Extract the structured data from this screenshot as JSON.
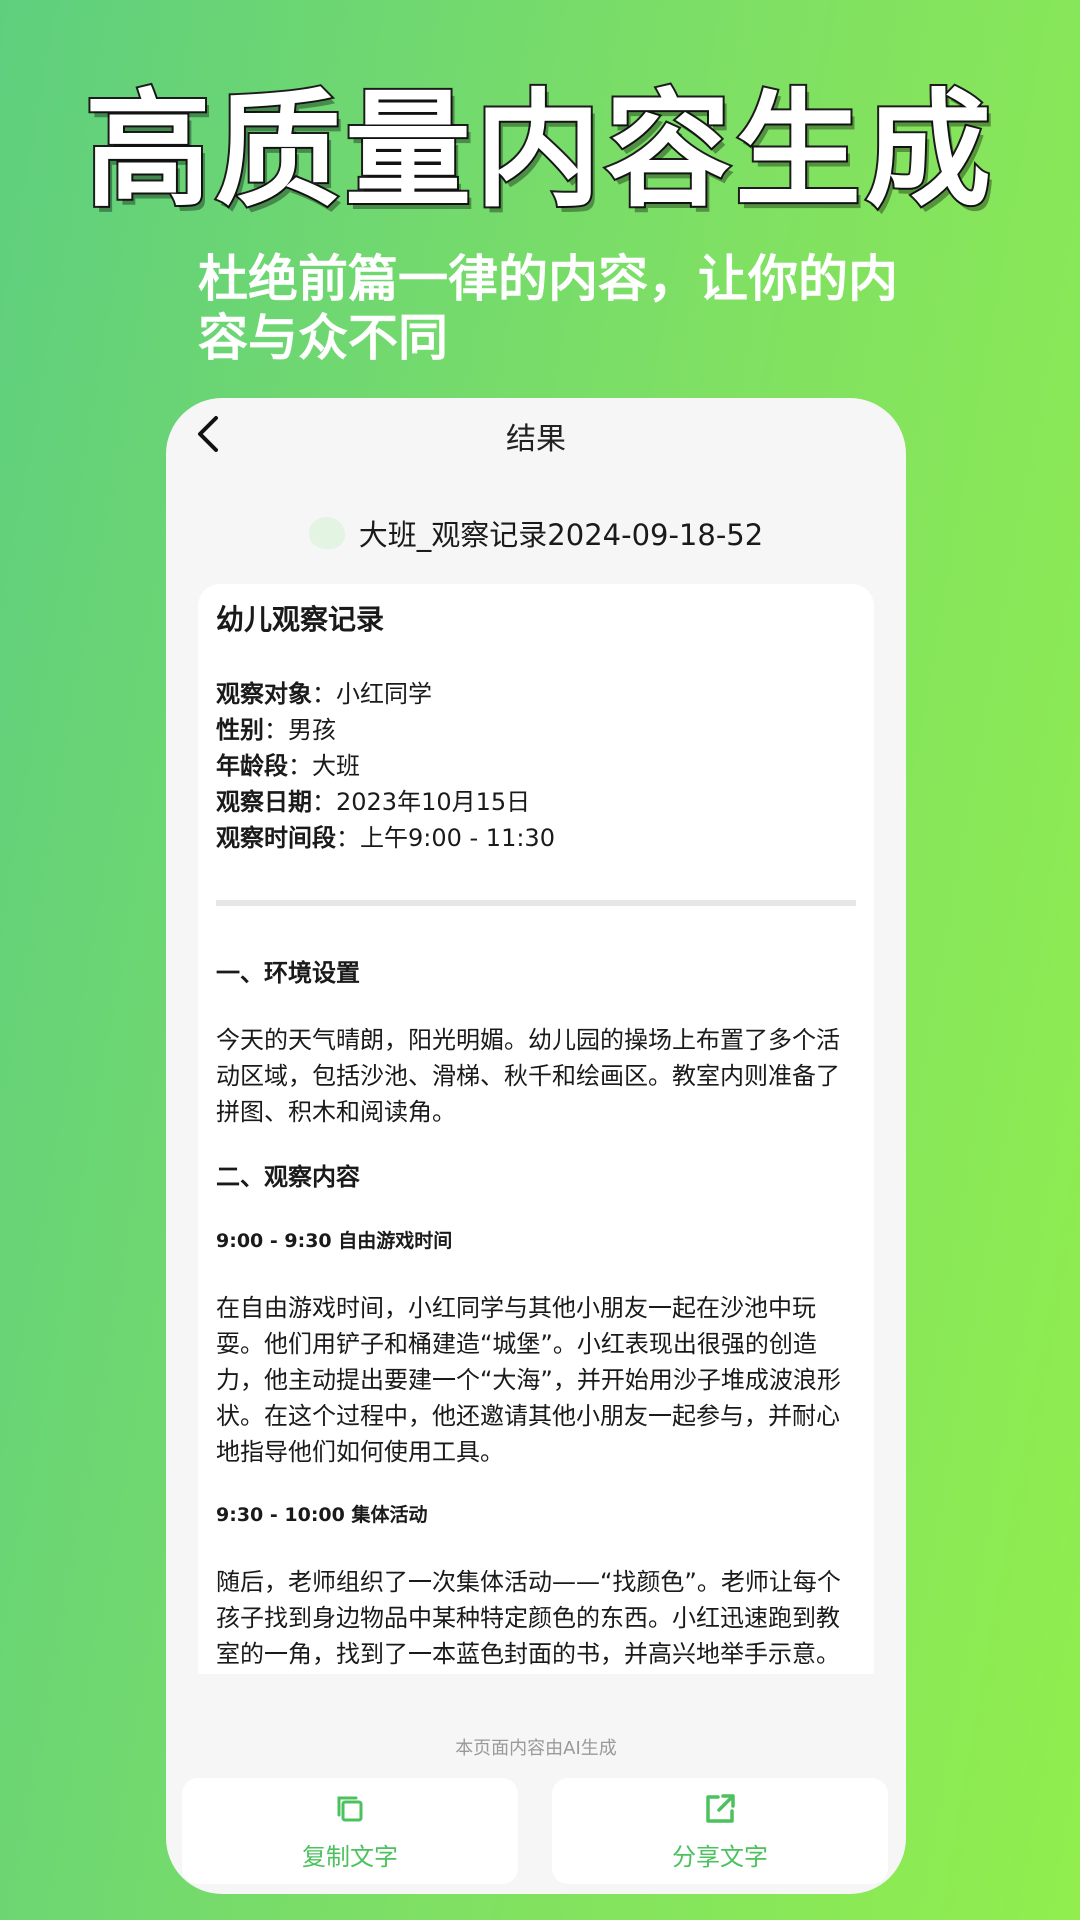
{
  "promo": {
    "headline": "高质量内容生成",
    "subhead_line1": "杜绝前篇一律的内容，让你的内",
    "subhead_line2": "容与众不同"
  },
  "nav": {
    "title": "结果",
    "back_icon": "chevron-left-icon"
  },
  "document": {
    "icon": "leaf-icon",
    "title": "大班_观察记录2024-09-18-52"
  },
  "report": {
    "title": "幼儿观察记录",
    "info": [
      {
        "key": "观察对象",
        "value": "小红同学"
      },
      {
        "key": "性别",
        "value": "男孩"
      },
      {
        "key": "年龄段",
        "value": "大班"
      },
      {
        "key": "观察日期",
        "value": "2023年10月15日"
      },
      {
        "key": "观察时间段",
        "value": "上午9:00 - 11:30"
      }
    ],
    "section1_title": "一、环境设置",
    "section1_text": "今天的天气晴朗，阳光明媚。幼儿园的操场上布置了多个活动区域，包括沙池、滑梯、秋千和绘画区。教室内则准备了拼图、积木和阅读角。",
    "section2_title": "二、观察内容",
    "period1_title": "9:00 - 9:30 自由游戏时间",
    "period1_text": "在自由游戏时间，小红同学与其他小朋友一起在沙池中玩耍。他们用铲子和桶建造“城堡”。小红表现出很强的创造力，他主动提出要建一个“大海”，并开始用沙子堆成波浪形状。在这个过程中，他还邀请其他小朋友一起参与，并耐心地指导他们如何使用工具。",
    "period2_title": "9:30 - 10:00 集体活动",
    "period2_text": "随后，老师组织了一次集体活动——“找颜色”。老师让每个孩子找到身边物品中某种特定颜色的东西。小红迅速跑到教室的一角，找到了一本蓝色封面的书，并高兴地举手示意。他不仅自己找到了，还帮助旁边的小伙伴寻找，让大"
  },
  "footer": {
    "ai_note": "本页面内容由AI生成",
    "copy_label": "复制文字",
    "share_label": "分享文字",
    "copy_icon": "copy-icon",
    "share_icon": "share-external-icon"
  },
  "colors": {
    "accent": "#4cc25e",
    "bg_gradient_start": "#5fcf7e",
    "bg_gradient_end": "#91ee4e"
  }
}
